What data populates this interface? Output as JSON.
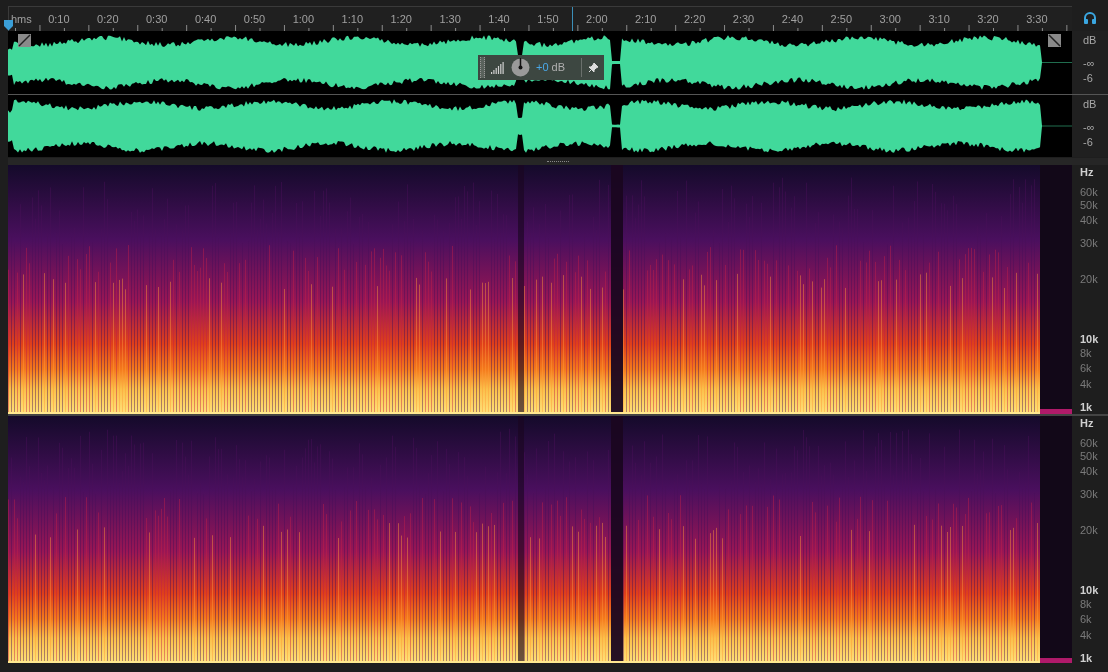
{
  "ruler": {
    "unit": "hms",
    "labels": [
      "0:10",
      "0:20",
      "0:30",
      "0:40",
      "0:50",
      "1:00",
      "1:10",
      "1:20",
      "1:30",
      "1:40",
      "1:50",
      "2:00",
      "2:10",
      "2:20",
      "2:30",
      "2:40",
      "2:50",
      "3:00",
      "3:10",
      "3:20",
      "3:30"
    ]
  },
  "waveform": {
    "channels": [
      {
        "labels": [
          "dB",
          "-∞",
          "-6"
        ]
      },
      {
        "labels": [
          "dB",
          "-∞",
          "-6"
        ]
      }
    ]
  },
  "gain_toolbar": {
    "value": "+0",
    "unit": "dB"
  },
  "spectrogram": {
    "channels": [
      {
        "labels": [
          {
            "text": "Hz",
            "major": true
          },
          {
            "text": "60k",
            "major": false
          },
          {
            "text": "50k",
            "major": false
          },
          {
            "text": "40k",
            "major": false
          },
          {
            "text": "30k",
            "major": false
          },
          {
            "text": "20k",
            "major": false
          },
          {
            "text": "10k",
            "major": true
          },
          {
            "text": "8k",
            "major": false
          },
          {
            "text": "6k",
            "major": false
          },
          {
            "text": "4k",
            "major": false
          },
          {
            "text": "1k",
            "major": true
          }
        ]
      },
      {
        "labels": [
          {
            "text": "Hz",
            "major": true
          },
          {
            "text": "60k",
            "major": false
          },
          {
            "text": "50k",
            "major": false
          },
          {
            "text": "40k",
            "major": false
          },
          {
            "text": "30k",
            "major": false
          },
          {
            "text": "20k",
            "major": false
          },
          {
            "text": "10k",
            "major": true
          },
          {
            "text": "8k",
            "major": false
          },
          {
            "text": "6k",
            "major": false
          },
          {
            "text": "4k",
            "major": false
          },
          {
            "text": "1k",
            "major": true
          }
        ]
      }
    ]
  }
}
